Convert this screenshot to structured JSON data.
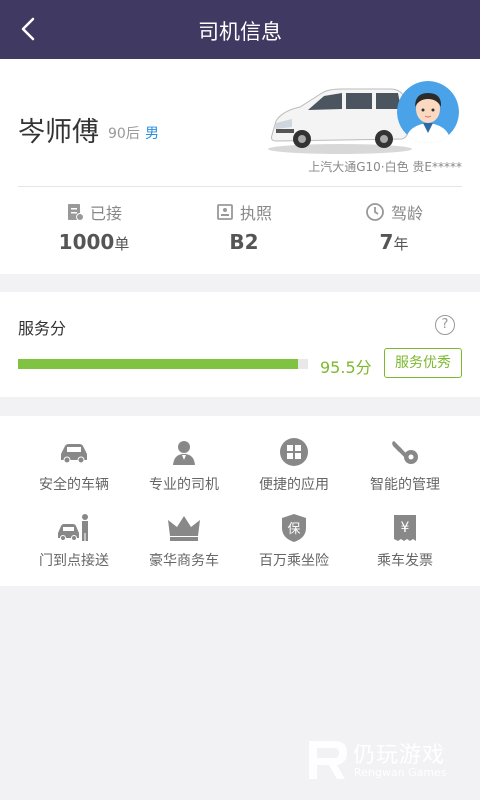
{
  "header": {
    "title": "司机信息"
  },
  "driver": {
    "name": "岑师傅",
    "age_group": "90后",
    "gender": "男",
    "vehicle": "上汽大通G10·白色  贵E*****"
  },
  "stats": [
    {
      "label": "已接",
      "value": "1000",
      "unit": "单",
      "icon": "order-doc-icon"
    },
    {
      "label": "执照",
      "value": "B2",
      "unit": "",
      "icon": "license-icon"
    },
    {
      "label": "驾龄",
      "value": "7",
      "unit": "年",
      "icon": "clock-icon"
    }
  ],
  "score": {
    "title": "服务分",
    "help_glyph": "?",
    "value_text": "95.5分",
    "progress_fraction": 0.965,
    "badge": "服务优秀"
  },
  "features": [
    {
      "label": "安全的车辆",
      "icon": "car-icon"
    },
    {
      "label": "专业的司机",
      "icon": "driver-person-icon"
    },
    {
      "label": "便捷的应用",
      "icon": "app-grid-icon"
    },
    {
      "label": "智能的管理",
      "icon": "wrench-gear-icon"
    },
    {
      "label": "门到点接送",
      "icon": "car-person-icon"
    },
    {
      "label": "豪华商务车",
      "icon": "crown-icon"
    },
    {
      "label": "百万乘坐险",
      "icon": "shield-insurance-icon"
    },
    {
      "label": "乘车发票",
      "icon": "invoice-icon"
    }
  ],
  "watermark": {
    "title": "仍玩游戏",
    "subtitle": "Rengwan Games"
  },
  "colors": {
    "header": "#403a63",
    "accent_green": "#7cb92f",
    "gender_blue": "#2a8de0"
  }
}
